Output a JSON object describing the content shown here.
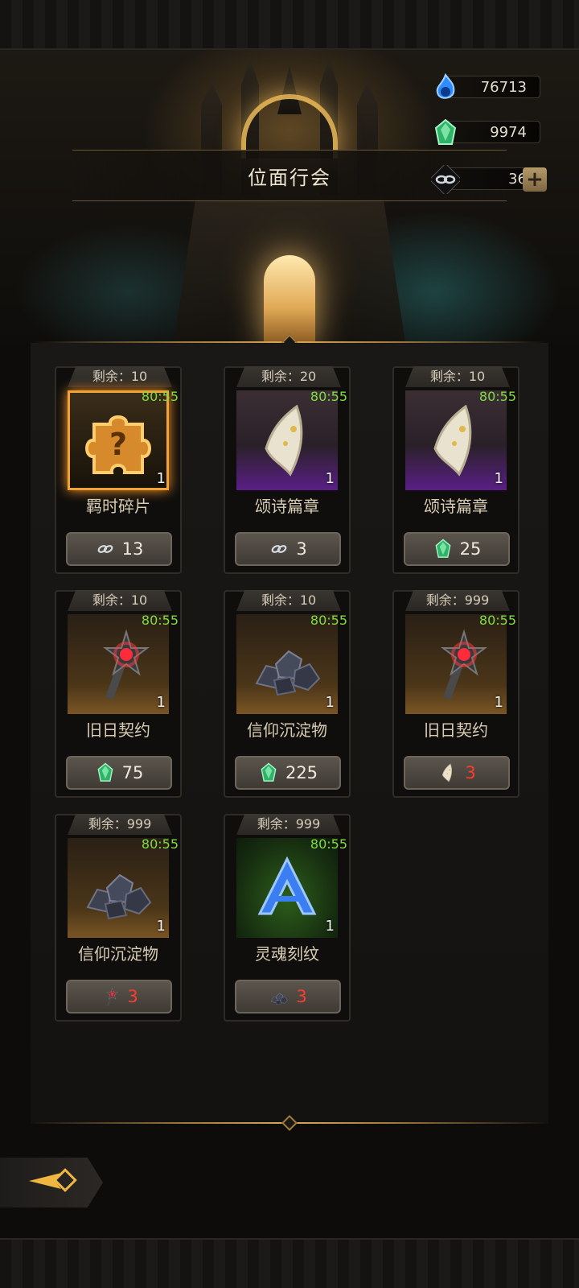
{
  "header": {
    "title": "位面行会"
  },
  "currencies": [
    {
      "icon": "blue-soul-flame-icon",
      "value": "76713"
    },
    {
      "icon": "green-crystal-icon",
      "value": "9974"
    },
    {
      "icon": "chain-link-icon",
      "value": "36"
    }
  ],
  "items": [
    {
      "remain": "剩余：10",
      "timer": "80:55",
      "qty": "1",
      "name": "羁时碎片",
      "icon": "puzzle-piece-icon",
      "price_icon": "chain-link-icon",
      "price": "13",
      "price_color": "#efe9dc"
    },
    {
      "remain": "剩余：20",
      "timer": "80:55",
      "qty": "1",
      "name": "颂诗篇章",
      "icon": "scroll-page-icon",
      "price_icon": "chain-link-icon",
      "price": "3",
      "price_color": "#efe9dc"
    },
    {
      "remain": "剩余：10",
      "timer": "80:55",
      "qty": "1",
      "name": "颂诗篇章",
      "icon": "scroll-page-icon",
      "price_icon": "green-crystal-icon",
      "price": "25",
      "price_color": "#efe9dc"
    },
    {
      "remain": "剩余：10",
      "timer": "80:55",
      "qty": "1",
      "name": "旧日契约",
      "icon": "spiked-mace-icon",
      "price_icon": "green-crystal-icon",
      "price": "75",
      "price_color": "#efe9dc"
    },
    {
      "remain": "剩余：10",
      "timer": "80:55",
      "qty": "1",
      "name": "信仰沉淀物",
      "icon": "ore-pile-icon",
      "price_icon": "green-crystal-icon",
      "price": "225",
      "price_color": "#efe9dc"
    },
    {
      "remain": "剩余：999",
      "timer": "80:55",
      "qty": "1",
      "name": "旧日契约",
      "icon": "spiked-mace-icon",
      "price_icon": "scroll-page-icon",
      "price": "3",
      "price_color": "#ff3b2f"
    },
    {
      "remain": "剩余：999",
      "timer": "80:55",
      "qty": "1",
      "name": "信仰沉淀物",
      "icon": "ore-pile-icon",
      "price_icon": "spiked-mace-icon",
      "price": "3",
      "price_color": "#ff3b2f"
    },
    {
      "remain": "剩余：999",
      "timer": "80:55",
      "qty": "1",
      "name": "灵魂刻纹",
      "icon": "soul-rune-icon",
      "price_icon": "ore-pile-icon",
      "price": "3",
      "price_color": "#ff3b2f"
    }
  ],
  "colors": {
    "timer": "#7fdc3e",
    "insufficient": "#ff3b2f",
    "gold_accent": "#d9a852"
  }
}
